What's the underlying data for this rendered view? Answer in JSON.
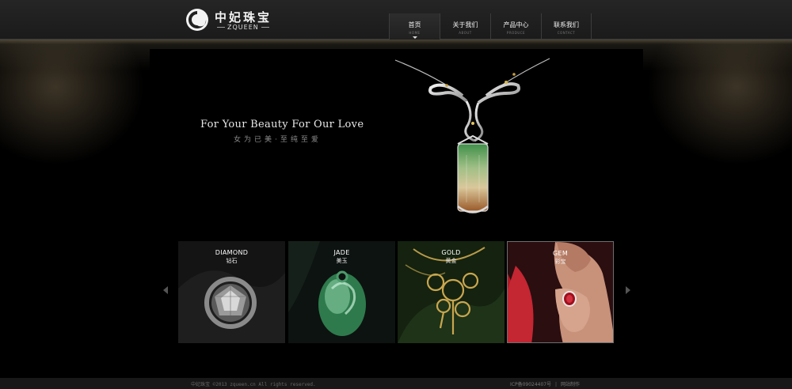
{
  "header": {
    "logo": {
      "cn": "中妃珠宝",
      "en": "ZQUEEN"
    },
    "nav": [
      {
        "cn": "首页",
        "en": "HOME",
        "active": true
      },
      {
        "cn": "关于我们",
        "en": "ABOUT",
        "active": false
      },
      {
        "cn": "产品中心",
        "en": "PRODUCE",
        "active": false
      },
      {
        "cn": "联系我们",
        "en": "CONTACT",
        "active": false
      }
    ]
  },
  "banner": {
    "tagline": "For Your Beauty  For Our Love",
    "tagline_cn": "女为已美·至纯至爱"
  },
  "products": [
    {
      "en": "DIAMOND",
      "cn": "钻石"
    },
    {
      "en": "JADE",
      "cn": "美玉"
    },
    {
      "en": "GOLD",
      "cn": "黄金"
    },
    {
      "en": "GEM",
      "cn": "彩宝"
    }
  ],
  "footer": {
    "copyright": "中妃珠宝 ©2013 zqueen.cn All rights reserved.",
    "icp": "ICP备09024407号",
    "separator": "|",
    "design": "网站制作"
  },
  "colors": {
    "background": "#000000",
    "header": "#1f1f1f",
    "accent_gold": "#b89a4a"
  }
}
